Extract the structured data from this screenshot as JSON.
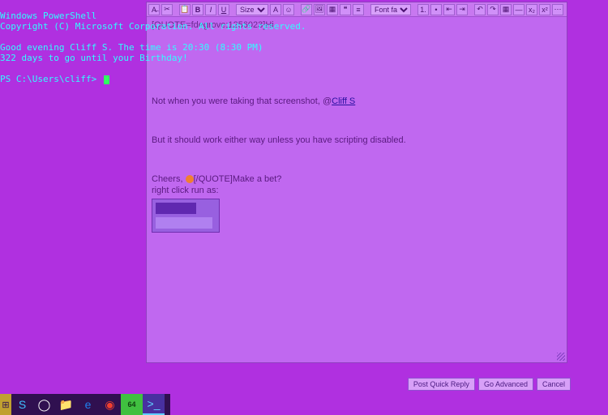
{
  "terminal": {
    "line1": "Windows PowerShell",
    "line2": "Copyright (C) Microsoft Corporation. All rights reserved.",
    "line3": "",
    "line4": "Good evening Cliff S. The time is 20:30 (8:30 PM)",
    "line5": "322 days to go until your Birthday!",
    "line6": "",
    "prompt": "PS C:\\Users\\cliff> "
  },
  "toolbar": {
    "strike": "A̶",
    "cut": "✂",
    "paste": "📋",
    "bold": "B",
    "italic": "I",
    "underline": "U",
    "size_label": "Size",
    "color": "A",
    "smile": "☺",
    "link": "🔗",
    "img": "🖼",
    "video": "▦",
    "quote": "❝",
    "code": "≡",
    "font_label": "Font fa...",
    "olist": "1.",
    "ulist": "•",
    "indent_l": "⇤",
    "indent_r": "⇥",
    "undo": "↶",
    "redo": "↷",
    "table": "▦",
    "hr": "—",
    "sub": "x₂",
    "sup": "x²",
    "more": "⋯"
  },
  "editor": {
    "quote_open": "[QUOTE=fdegrove;1256023]Hi,",
    "l1a": "Not when you were taking that screenshot, @",
    "mention": "Cliff S",
    "l2": "But it should work either way unless you have scripting disabled.",
    "l3a": "Cheers, ",
    "l3b": "[/QUOTE]Make a bet?",
    "l4": "right click run as:"
  },
  "actions": {
    "post": "Post Quick Reply",
    "adv": "Go Advanced",
    "cancel": "Cancel"
  },
  "taskbar": {
    "start": "⊞",
    "skype": "S",
    "cortana": "◯",
    "file": "📁",
    "edge": "e",
    "chrome": "◉",
    "x64": "64",
    "ps": ">_"
  }
}
